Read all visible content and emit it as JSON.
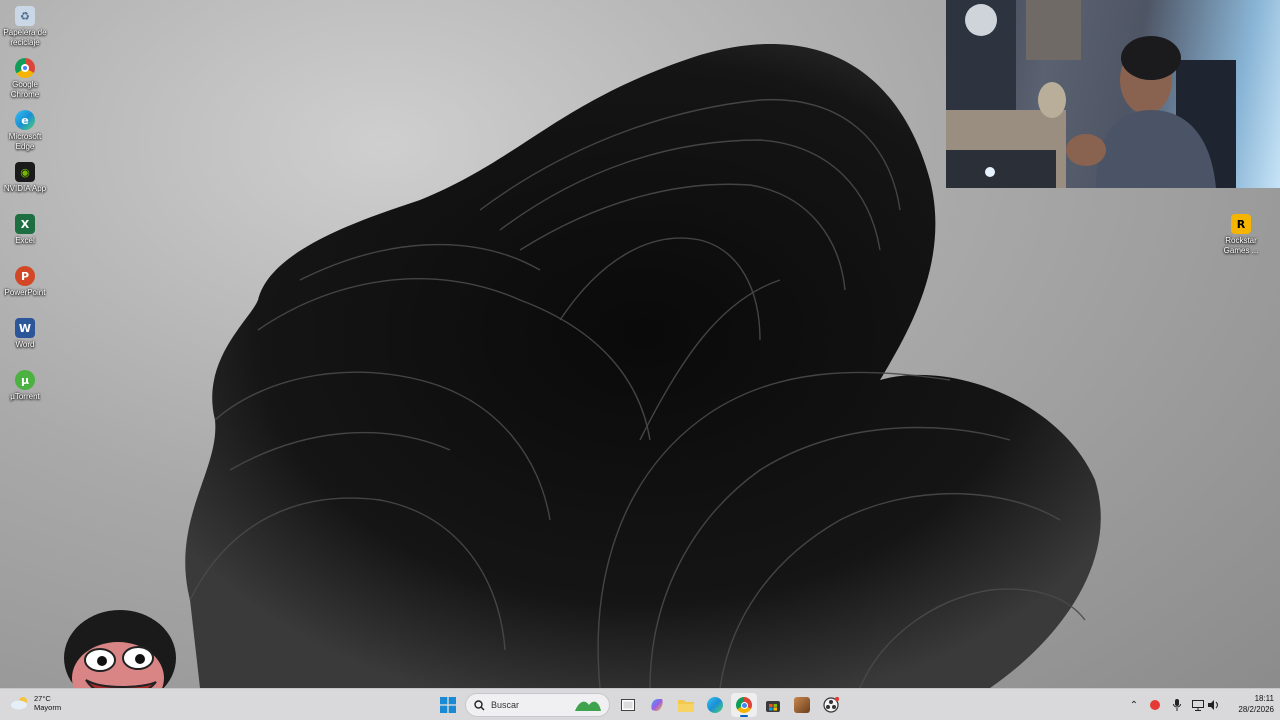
{
  "desktop": {
    "icons_left": [
      {
        "label": "Papelera de reciclaje",
        "icon": "recycle-bin-icon",
        "color": "#6c8fb5"
      },
      {
        "label": "Google Chrome",
        "icon": "chrome-icon",
        "color": "#db4437"
      },
      {
        "label": "Microsoft Edge",
        "icon": "edge-icon",
        "color": "#1b8fd6"
      },
      {
        "label": "NVIDIA App",
        "icon": "nvidia-icon",
        "color": "#76b900"
      },
      {
        "label": "Excel",
        "icon": "excel-icon",
        "color": "#1d6f42"
      },
      {
        "label": "PowerPoint",
        "icon": "powerpoint-icon",
        "color": "#d24726"
      },
      {
        "label": "Word",
        "icon": "word-icon",
        "color": "#2b579a"
      },
      {
        "label": "µTorrent",
        "icon": "utorrent-icon",
        "color": "#4bb141"
      }
    ],
    "icon_right": {
      "label": "Rockstar Games ...",
      "icon": "rockstar-icon",
      "color": "#f4b400"
    }
  },
  "taskbar": {
    "weather": {
      "temp": "27°C",
      "desc": "Mayorm"
    },
    "search_label": "Buscar",
    "pinned": [
      "start-icon",
      "copilot-icon",
      "task-view-icon",
      "copilot-app-icon",
      "file-explorer-icon",
      "edge-icon",
      "chrome-icon",
      "store-icon",
      "game-icon",
      "obs-icon"
    ],
    "clock": {
      "time": "18:11",
      "date": "28/2/2026"
    }
  },
  "colors": {
    "taskbar": "#d9d9dc",
    "accent": "#0067c0"
  }
}
